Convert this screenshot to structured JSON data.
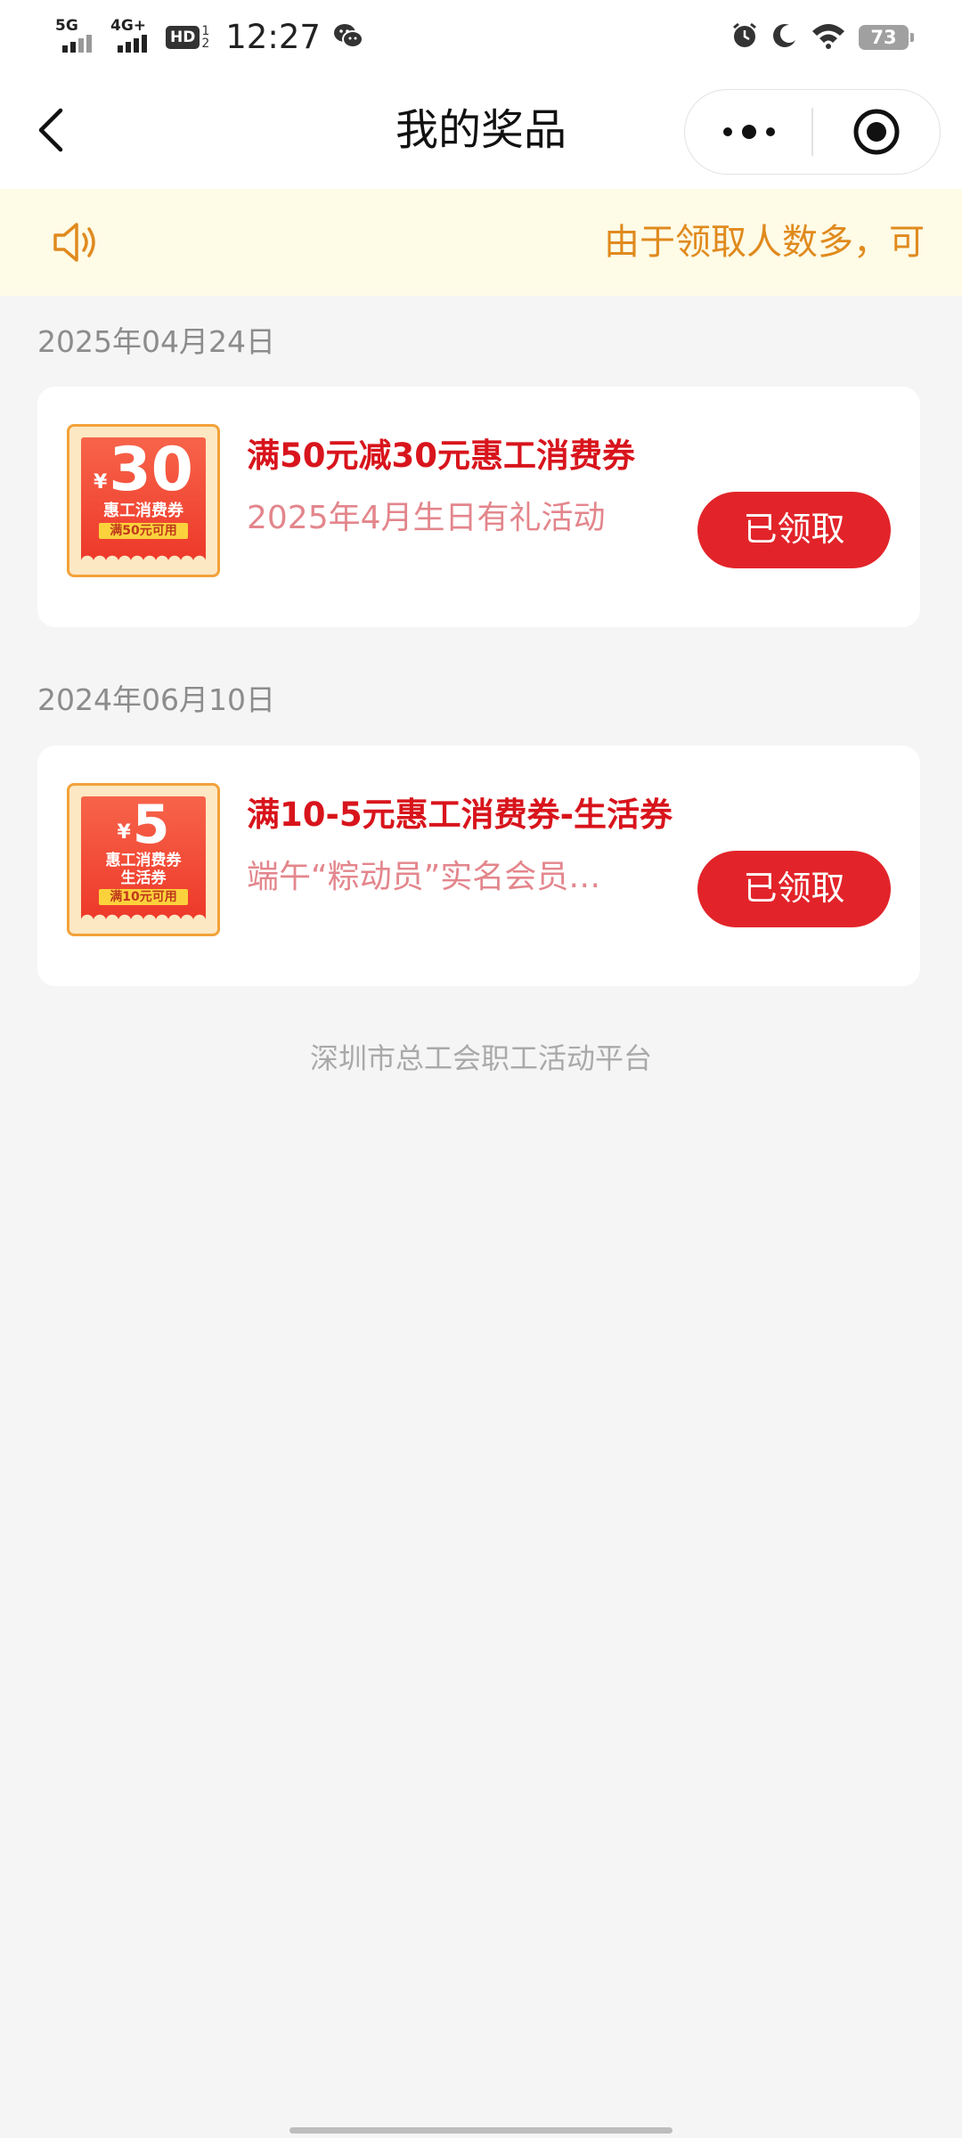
{
  "status_bar": {
    "signal_1": "5G",
    "signal_2": "4G+",
    "hd_badge": "HD",
    "hd_sub_top": "1",
    "hd_sub_bottom": "2",
    "time": "12:27",
    "battery": "73",
    "icons": [
      "wechat-icon",
      "alarm-icon",
      "moon-icon",
      "wifi-icon",
      "battery-icon"
    ]
  },
  "nav": {
    "title": "我的奖品",
    "icons": [
      "chevron-left-icon",
      "more-dots-icon",
      "target-close-icon"
    ]
  },
  "notice": {
    "icon": "speaker-icon",
    "text": "由于领取人数多，可",
    "color": "#e08a1e"
  },
  "prizes": [
    {
      "date": "2025年04月24日",
      "coupon_yen": "¥",
      "coupon_amount": "30",
      "coupon_name_1": "惠工消费券",
      "coupon_name_2": "",
      "coupon_tag": "满50元可用",
      "title": "满50元减30元惠工消费券",
      "subtitle": "2025年4月生日有礼活动",
      "button": "已领取"
    },
    {
      "date": "2024年06月10日",
      "coupon_yen": "¥",
      "coupon_amount": "5",
      "coupon_name_1": "惠工消费券",
      "coupon_name_2": "生活券",
      "coupon_tag": "满10元可用",
      "title": "满10-5元惠工消费券-生活券",
      "subtitle": "端午“粽动员”实名会员…",
      "button": "已领取"
    }
  ],
  "footer": "深圳市总工会职工活动平台",
  "colors": {
    "title_red": "#d8141c",
    "subtitle_pink": "#e3868c",
    "button_red": "#e2242a",
    "notice_bg": "#fefbe6",
    "page_bg": "#f5f5f5"
  }
}
